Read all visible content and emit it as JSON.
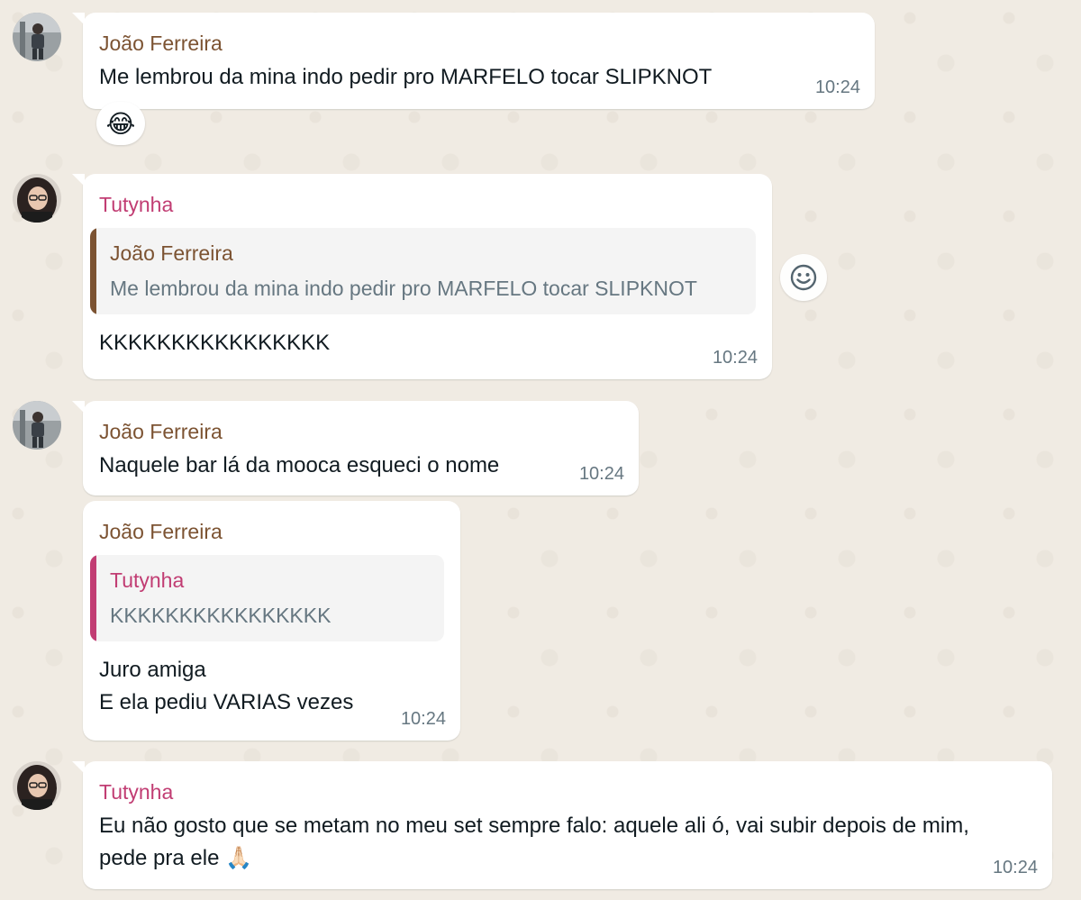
{
  "messages": [
    {
      "sender": "João Ferreira",
      "text": "Me lembrou da mina indo pedir pro MARFELO tocar SLIPKNOT",
      "time": "10:24",
      "reaction": "😂"
    },
    {
      "sender": "Tutynha",
      "quote": {
        "sender": "João Ferreira",
        "text": "Me lembrou da mina indo pedir pro MARFELO tocar SLIPKNOT"
      },
      "text": "KKKKKKKKKKKKKKKK",
      "time": "10:24",
      "reaction_button": "smiley-icon"
    },
    {
      "sender": "João Ferreira",
      "text": "Naquele bar lá da mooca esqueci o nome",
      "time": "10:24"
    },
    {
      "sender": "João Ferreira",
      "quote": {
        "sender": "Tutynha",
        "text": "KKKKKKKKKKKKKKKK"
      },
      "text": "Juro amiga\nE ela pediu VARIAS vezes",
      "time": "10:24"
    },
    {
      "sender": "Tutynha",
      "text": "Eu não gosto que se metam no meu set sempre falo: aquele ali ó, vai subir depois de mim, pede pra ele 🙏🏻",
      "time": "10:24"
    }
  ],
  "colors": {
    "background": "#f0ebe3",
    "bubble": "#ffffff",
    "joao_name": "#7c5332",
    "tutynha_name": "#c13d73",
    "timestamp": "#667781"
  }
}
